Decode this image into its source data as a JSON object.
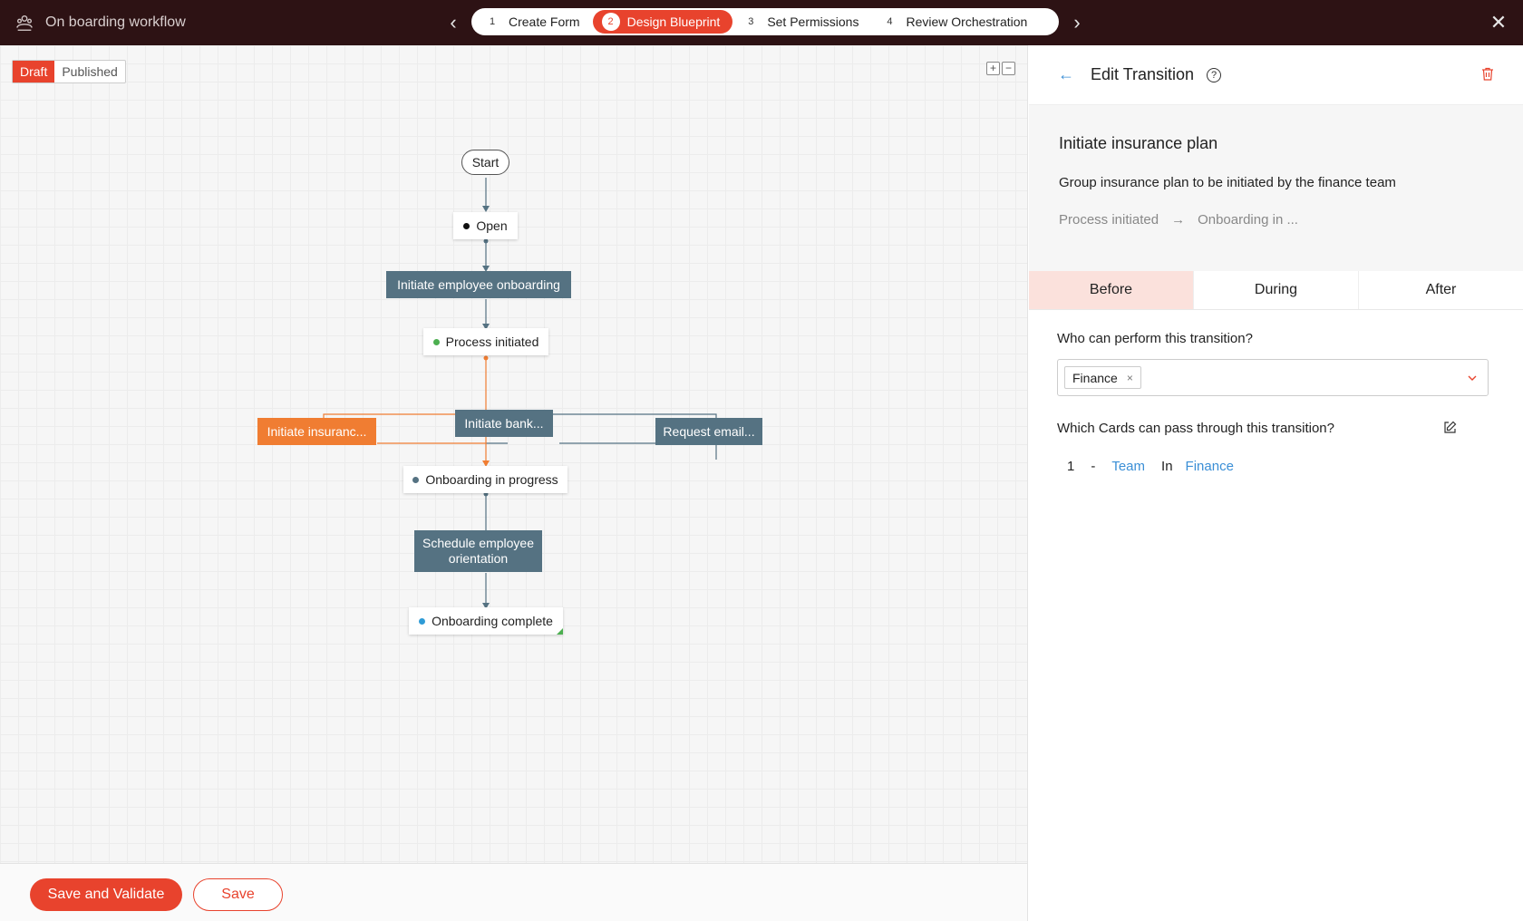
{
  "topbar": {
    "app_title": "On boarding workflow",
    "steps": [
      {
        "num": "1",
        "label": "Create Form"
      },
      {
        "num": "2",
        "label": "Design Blueprint"
      },
      {
        "num": "3",
        "label": "Set Permissions"
      },
      {
        "num": "4",
        "label": "Review Orchestration"
      }
    ],
    "active_step": "2",
    "prev_icon": "chevron-left-icon",
    "next_icon": "chevron-right-icon",
    "close_icon": "close-icon"
  },
  "canvas": {
    "status_draft": "Draft",
    "status_published": "Published",
    "zoom_in": "+",
    "zoom_out": "−",
    "nodes": {
      "start": "Start",
      "open": "Open",
      "initiate_onboarding": "Initiate employee onboarding",
      "process_initiated": "Process initiated",
      "initiate_insurance": "Initiate insuranc...",
      "initiate_bank": "Initiate bank...",
      "request_email": "Request email...",
      "onboarding_in_progress": "Onboarding in progress",
      "schedule_line1": "Schedule employee",
      "schedule_line2": "orientation",
      "onboarding_complete": "Onboarding complete"
    },
    "colors": {
      "transition": "#557282",
      "highlight": "#f07d32",
      "dot_open": "#111111",
      "dot_process": "#4caf50",
      "dot_progress": "#557282",
      "dot_complete": "#2f9bd6"
    }
  },
  "footer": {
    "save_validate": "Save and Validate",
    "save": "Save"
  },
  "panel": {
    "title": "Edit Transition",
    "help": "?",
    "transition_name": "Initiate insurance plan",
    "transition_desc": "Group insurance plan to be initiated by the finance team",
    "from_state": "Process initiated",
    "arrow": "→",
    "to_state": "Onboarding in ...",
    "tabs": [
      "Before",
      "During",
      "After"
    ],
    "who_label": "Who can perform this transition?",
    "who_value": "Finance",
    "chip_remove": "×",
    "dropdown_chevron": "⌄",
    "cards_label": "Which Cards can pass through this transition?",
    "rule": {
      "num": "1",
      "dash": "-",
      "field": "Team",
      "op": "In",
      "value": "Finance"
    },
    "accent": "#e8432d",
    "link": "#3b8fd6"
  }
}
